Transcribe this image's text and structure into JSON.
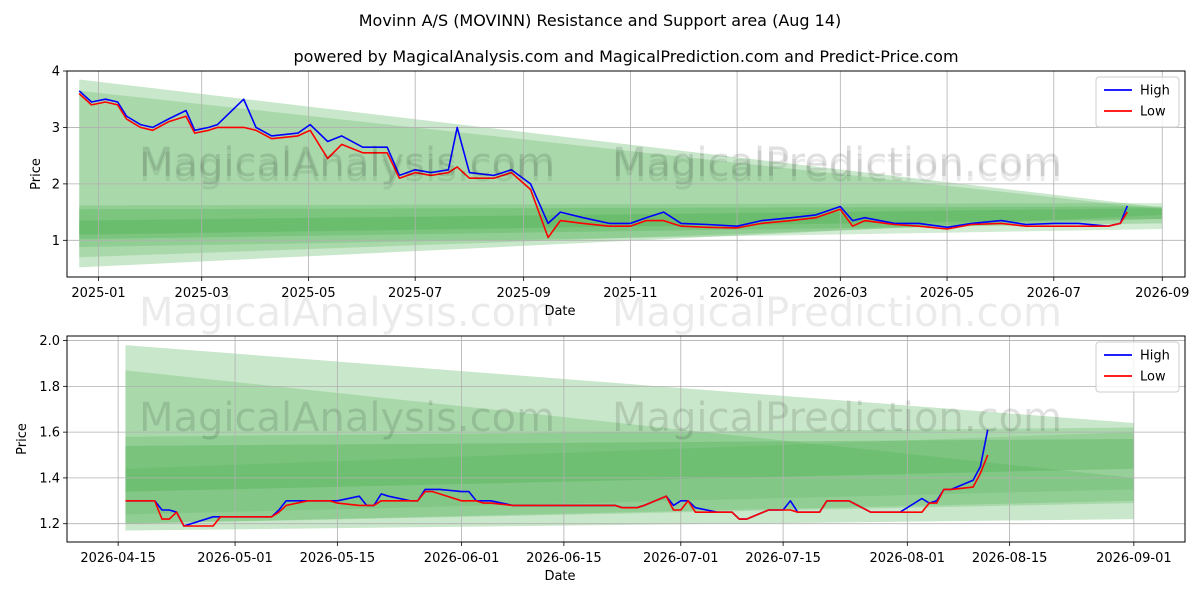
{
  "title": "Movinn A/S (MOVINN) Resistance and Support area (Aug 14)",
  "subtitle": "powered by MagicalAnalysis.com and MagicalPrediction.com and Predict-Price.com",
  "watermarks": [
    "MagicalAnalysis.com",
    "MagicalPrediction.com"
  ],
  "colors": {
    "high": "#0000ff",
    "low": "#ff0000",
    "band": "#4caf50",
    "grid": "#b0b0b0"
  },
  "chart_data": [
    {
      "type": "line",
      "xlabel": "Date",
      "ylabel": "Price",
      "xlim": [
        "2024-12-14",
        "2026-09-14"
      ],
      "ylim": [
        0.35,
        4.0
      ],
      "x_ticks": [
        "2025-01",
        "2025-03",
        "2025-05",
        "2025-07",
        "2025-09",
        "2025-11",
        "2026-01",
        "2026-03",
        "2026-05",
        "2026-07",
        "2026-09"
      ],
      "y_ticks": [
        1,
        2,
        3,
        4
      ],
      "grid": true,
      "legend": {
        "position": "top-right",
        "entries": [
          "High",
          "Low"
        ]
      },
      "bands": [
        {
          "x": [
            "2024-12-21",
            "2026-09-01"
          ],
          "top": [
            3.85,
            1.58
          ],
          "bottom": [
            0.52,
            1.45
          ],
          "opacity": 0.3
        },
        {
          "x": [
            "2024-12-21",
            "2026-09-01"
          ],
          "top": [
            3.65,
            1.55
          ],
          "bottom": [
            0.7,
            1.38
          ],
          "opacity": 0.25
        },
        {
          "x": [
            "2024-12-21",
            "2026-09-01"
          ],
          "top": [
            1.62,
            1.66
          ],
          "bottom": [
            0.88,
            1.2
          ],
          "opacity": 0.25
        },
        {
          "x": [
            "2024-12-21",
            "2026-09-01"
          ],
          "top": [
            1.55,
            1.6
          ],
          "bottom": [
            1.02,
            1.3
          ],
          "opacity": 0.3
        },
        {
          "x": [
            "2024-12-21",
            "2026-09-01"
          ],
          "top": [
            1.35,
            1.57
          ],
          "bottom": [
            1.1,
            1.38
          ],
          "opacity": 0.35
        }
      ],
      "series": [
        {
          "name": "High",
          "x": [
            "2024-12-21",
            "2024-12-28",
            "2025-01-05",
            "2025-01-12",
            "2025-01-17",
            "2025-01-25",
            "2025-02-01",
            "2025-02-10",
            "2025-02-20",
            "2025-02-25",
            "2025-03-05",
            "2025-03-10",
            "2025-03-25",
            "2025-04-01",
            "2025-04-10",
            "2025-04-25",
            "2025-05-02",
            "2025-05-12",
            "2025-05-20",
            "2025-06-01",
            "2025-06-15",
            "2025-06-22",
            "2025-07-01",
            "2025-07-10",
            "2025-07-20",
            "2025-07-25",
            "2025-08-01",
            "2025-08-15",
            "2025-08-25",
            "2025-09-05",
            "2025-09-15",
            "2025-09-22",
            "2025-10-05",
            "2025-10-20",
            "2025-11-01",
            "2025-11-10",
            "2025-11-20",
            "2025-11-30",
            "2025-12-15",
            "2026-01-01",
            "2026-01-15",
            "2026-02-01",
            "2026-02-15",
            "2026-03-01",
            "2026-03-08",
            "2026-03-15",
            "2026-04-01",
            "2026-04-15",
            "2026-05-01",
            "2026-05-15",
            "2026-06-01",
            "2026-06-15",
            "2026-07-01",
            "2026-07-15",
            "2026-08-01",
            "2026-08-08",
            "2026-08-12"
          ],
          "values": [
            3.65,
            3.45,
            3.5,
            3.45,
            3.2,
            3.05,
            3.0,
            3.15,
            3.3,
            2.95,
            3.0,
            3.05,
            3.5,
            3.0,
            2.85,
            2.9,
            3.05,
            2.75,
            2.85,
            2.65,
            2.65,
            2.15,
            2.25,
            2.2,
            2.25,
            3.0,
            2.2,
            2.15,
            2.25,
            2.0,
            1.3,
            1.5,
            1.4,
            1.3,
            1.3,
            1.4,
            1.5,
            1.3,
            1.28,
            1.25,
            1.35,
            1.4,
            1.45,
            1.6,
            1.35,
            1.4,
            1.3,
            1.3,
            1.23,
            1.3,
            1.35,
            1.28,
            1.3,
            1.3,
            1.25,
            1.3,
            1.61
          ]
        },
        {
          "name": "Low",
          "x": [
            "2024-12-21",
            "2024-12-28",
            "2025-01-05",
            "2025-01-12",
            "2025-01-17",
            "2025-01-25",
            "2025-02-01",
            "2025-02-10",
            "2025-02-20",
            "2025-02-25",
            "2025-03-05",
            "2025-03-10",
            "2025-03-25",
            "2025-04-01",
            "2025-04-10",
            "2025-04-25",
            "2025-05-02",
            "2025-05-12",
            "2025-05-20",
            "2025-06-01",
            "2025-06-15",
            "2025-06-22",
            "2025-07-01",
            "2025-07-10",
            "2025-07-20",
            "2025-07-25",
            "2025-08-01",
            "2025-08-15",
            "2025-08-25",
            "2025-09-05",
            "2025-09-15",
            "2025-09-22",
            "2025-10-05",
            "2025-10-20",
            "2025-11-01",
            "2025-11-10",
            "2025-11-20",
            "2025-11-30",
            "2025-12-15",
            "2026-01-01",
            "2026-01-15",
            "2026-02-01",
            "2026-02-15",
            "2026-03-01",
            "2026-03-08",
            "2026-03-15",
            "2026-04-01",
            "2026-04-15",
            "2026-05-01",
            "2026-05-15",
            "2026-06-01",
            "2026-06-15",
            "2026-07-01",
            "2026-07-15",
            "2026-08-01",
            "2026-08-08",
            "2026-08-12"
          ],
          "values": [
            3.6,
            3.4,
            3.45,
            3.4,
            3.15,
            3.0,
            2.95,
            3.1,
            3.2,
            2.9,
            2.95,
            3.0,
            3.0,
            2.95,
            2.8,
            2.85,
            2.95,
            2.45,
            2.7,
            2.55,
            2.55,
            2.1,
            2.2,
            2.15,
            2.2,
            2.3,
            2.1,
            2.1,
            2.2,
            1.9,
            1.05,
            1.35,
            1.3,
            1.25,
            1.25,
            1.35,
            1.35,
            1.25,
            1.23,
            1.22,
            1.3,
            1.35,
            1.4,
            1.55,
            1.25,
            1.35,
            1.28,
            1.25,
            1.2,
            1.28,
            1.3,
            1.25,
            1.25,
            1.25,
            1.25,
            1.3,
            1.5
          ]
        }
      ]
    },
    {
      "type": "line",
      "xlabel": "Date",
      "ylabel": "Price",
      "xlim": [
        "2026-04-08",
        "2026-09-08"
      ],
      "ylim": [
        1.12,
        2.02
      ],
      "x_ticks": [
        "2026-04-15",
        "2026-05-01",
        "2026-05-15",
        "2026-06-01",
        "2026-06-15",
        "2026-07-01",
        "2026-07-15",
        "2026-08-01",
        "2026-08-15",
        "2026-09-01"
      ],
      "y_ticks": [
        1.2,
        1.4,
        1.6,
        1.8,
        2.0
      ],
      "grid": true,
      "legend": {
        "position": "top-right",
        "entries": [
          "High",
          "Low"
        ]
      },
      "bands": [
        {
          "x": [
            "2026-04-16",
            "2026-09-01"
          ],
          "top": [
            1.98,
            1.64
          ],
          "bottom": [
            1.17,
            1.22
          ],
          "opacity": 0.3
        },
        {
          "x": [
            "2026-04-16",
            "2026-09-01"
          ],
          "top": [
            1.87,
            1.4
          ],
          "bottom": [
            1.2,
            1.29
          ],
          "opacity": 0.25
        },
        {
          "x": [
            "2026-04-16",
            "2026-09-01"
          ],
          "top": [
            1.58,
            1.62
          ],
          "bottom": [
            1.2,
            1.3
          ],
          "opacity": 0.25
        },
        {
          "x": [
            "2026-04-16",
            "2026-09-01"
          ],
          "top": [
            1.54,
            1.57
          ],
          "bottom": [
            1.34,
            1.44
          ],
          "opacity": 0.35
        },
        {
          "x": [
            "2026-04-16",
            "2026-09-01"
          ],
          "top": [
            1.44,
            1.6
          ],
          "bottom": [
            1.24,
            1.35
          ],
          "opacity": 0.2
        }
      ],
      "series": [
        {
          "name": "High",
          "x": [
            "2026-04-16",
            "2026-04-20",
            "2026-04-21",
            "2026-04-22",
            "2026-04-23",
            "2026-04-24",
            "2026-04-28",
            "2026-04-29",
            "2026-04-30",
            "2026-05-01",
            "2026-05-05",
            "2026-05-06",
            "2026-05-07",
            "2026-05-08",
            "2026-05-11",
            "2026-05-12",
            "2026-05-13",
            "2026-05-14",
            "2026-05-15",
            "2026-05-18",
            "2026-05-19",
            "2026-05-20",
            "2026-05-21",
            "2026-05-22",
            "2026-05-25",
            "2026-05-26",
            "2026-05-27",
            "2026-05-28",
            "2026-05-29",
            "2026-06-01",
            "2026-06-02",
            "2026-06-03",
            "2026-06-04",
            "2026-06-05",
            "2026-06-08",
            "2026-06-09",
            "2026-06-10",
            "2026-06-11",
            "2026-06-12",
            "2026-06-15",
            "2026-06-16",
            "2026-06-17",
            "2026-06-18",
            "2026-06-19",
            "2026-06-22",
            "2026-06-23",
            "2026-06-24",
            "2026-06-25",
            "2026-06-26",
            "2026-06-29",
            "2026-06-30",
            "2026-07-01",
            "2026-07-02",
            "2026-07-03",
            "2026-07-06",
            "2026-07-07",
            "2026-07-08",
            "2026-07-09",
            "2026-07-10",
            "2026-07-13",
            "2026-07-14",
            "2026-07-15",
            "2026-07-16",
            "2026-07-17",
            "2026-07-20",
            "2026-07-21",
            "2026-07-22",
            "2026-07-23",
            "2026-07-24",
            "2026-07-27",
            "2026-07-28",
            "2026-07-29",
            "2026-07-30",
            "2026-07-31",
            "2026-08-03",
            "2026-08-04",
            "2026-08-05",
            "2026-08-06",
            "2026-08-07",
            "2026-08-10",
            "2026-08-11",
            "2026-08-12"
          ],
          "values": [
            1.3,
            1.3,
            1.26,
            1.26,
            1.25,
            1.19,
            1.23,
            1.23,
            1.23,
            1.23,
            1.23,
            1.23,
            1.26,
            1.3,
            1.3,
            1.3,
            1.3,
            1.3,
            1.3,
            1.32,
            1.28,
            1.28,
            1.33,
            1.32,
            1.3,
            1.3,
            1.35,
            1.35,
            1.35,
            1.34,
            1.34,
            1.3,
            1.3,
            1.3,
            1.28,
            1.28,
            1.28,
            1.28,
            1.28,
            1.28,
            1.28,
            1.28,
            1.28,
            1.28,
            1.28,
            1.27,
            1.27,
            1.27,
            1.28,
            1.32,
            1.28,
            1.3,
            1.3,
            1.27,
            1.25,
            1.25,
            1.25,
            1.22,
            1.22,
            1.26,
            1.26,
            1.26,
            1.3,
            1.25,
            1.25,
            1.3,
            1.3,
            1.3,
            1.3,
            1.25,
            1.25,
            1.25,
            1.25,
            1.25,
            1.31,
            1.29,
            1.3,
            1.35,
            1.35,
            1.39,
            1.45,
            1.61
          ]
        },
        {
          "name": "Low",
          "x": [
            "2026-04-16",
            "2026-04-20",
            "2026-04-21",
            "2026-04-22",
            "2026-04-23",
            "2026-04-24",
            "2026-04-28",
            "2026-04-29",
            "2026-04-30",
            "2026-05-01",
            "2026-05-05",
            "2026-05-06",
            "2026-05-07",
            "2026-05-08",
            "2026-05-11",
            "2026-05-12",
            "2026-05-13",
            "2026-05-14",
            "2026-05-15",
            "2026-05-18",
            "2026-05-19",
            "2026-05-20",
            "2026-05-21",
            "2026-05-22",
            "2026-05-25",
            "2026-05-26",
            "2026-05-27",
            "2026-05-28",
            "2026-05-29",
            "2026-06-01",
            "2026-06-02",
            "2026-06-03",
            "2026-06-04",
            "2026-06-05",
            "2026-06-08",
            "2026-06-09",
            "2026-06-10",
            "2026-06-11",
            "2026-06-12",
            "2026-06-15",
            "2026-06-16",
            "2026-06-17",
            "2026-06-18",
            "2026-06-19",
            "2026-06-22",
            "2026-06-23",
            "2026-06-24",
            "2026-06-25",
            "2026-06-26",
            "2026-06-29",
            "2026-06-30",
            "2026-07-01",
            "2026-07-02",
            "2026-07-03",
            "2026-07-06",
            "2026-07-07",
            "2026-07-08",
            "2026-07-09",
            "2026-07-10",
            "2026-07-13",
            "2026-07-14",
            "2026-07-15",
            "2026-07-16",
            "2026-07-17",
            "2026-07-20",
            "2026-07-21",
            "2026-07-22",
            "2026-07-23",
            "2026-07-24",
            "2026-07-27",
            "2026-07-28",
            "2026-07-29",
            "2026-07-30",
            "2026-07-31",
            "2026-08-03",
            "2026-08-04",
            "2026-08-05",
            "2026-08-06",
            "2026-08-07",
            "2026-08-10",
            "2026-08-11",
            "2026-08-12"
          ],
          "values": [
            1.3,
            1.3,
            1.22,
            1.22,
            1.25,
            1.19,
            1.19,
            1.23,
            1.23,
            1.23,
            1.23,
            1.23,
            1.25,
            1.28,
            1.3,
            1.3,
            1.3,
            1.3,
            1.29,
            1.28,
            1.28,
            1.28,
            1.3,
            1.3,
            1.3,
            1.3,
            1.34,
            1.34,
            1.33,
            1.3,
            1.3,
            1.3,
            1.29,
            1.29,
            1.28,
            1.28,
            1.28,
            1.28,
            1.28,
            1.28,
            1.28,
            1.28,
            1.28,
            1.28,
            1.28,
            1.27,
            1.27,
            1.27,
            1.28,
            1.32,
            1.26,
            1.26,
            1.3,
            1.25,
            1.25,
            1.25,
            1.25,
            1.22,
            1.22,
            1.26,
            1.26,
            1.26,
            1.26,
            1.25,
            1.25,
            1.3,
            1.3,
            1.3,
            1.3,
            1.25,
            1.25,
            1.25,
            1.25,
            1.25,
            1.25,
            1.29,
            1.29,
            1.35,
            1.35,
            1.36,
            1.42,
            1.5
          ]
        }
      ]
    }
  ]
}
